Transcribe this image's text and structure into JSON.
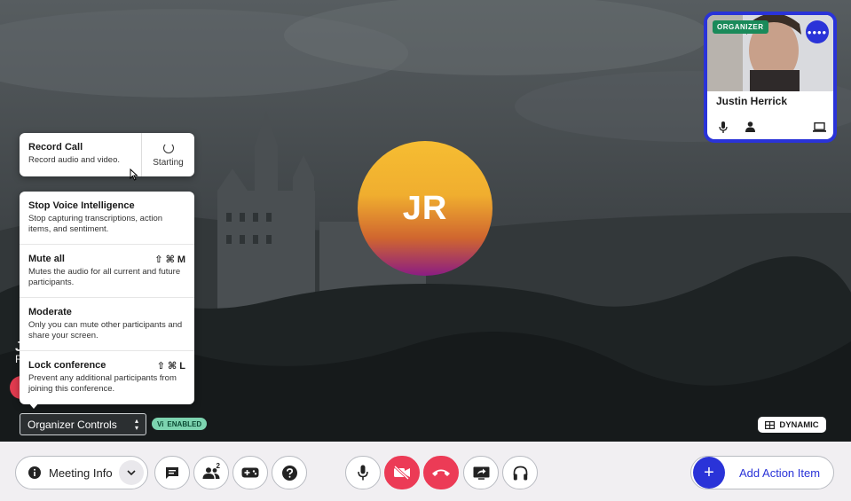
{
  "participant": {
    "badge": "ORGANIZER",
    "name": "Justin Herrick",
    "more_label": "••••"
  },
  "main_avatar": {
    "initials": "JR"
  },
  "record_menu": {
    "title": "Record Call",
    "description": "Record audio and video.",
    "status": "Starting"
  },
  "organizer_menu": {
    "items": [
      {
        "title": "Stop Voice Intelligence",
        "description": "Stop capturing transcriptions, action items, and sentiment.",
        "shortcut": ""
      },
      {
        "title": "Mute all",
        "description": "Mutes the audio for all current and future participants.",
        "shortcut": "⇧ ⌘ M"
      },
      {
        "title": "Moderate",
        "description": "Only you can mute other participants and share your screen.",
        "shortcut": ""
      },
      {
        "title": "Lock conference",
        "description": "Prevent any additional participants from joining this conference.",
        "shortcut": "⇧ ⌘ L"
      }
    ]
  },
  "controls_select": {
    "value": "Organizer Controls"
  },
  "vi_badge": {
    "prefix": "Vi",
    "label": "ENABLED"
  },
  "layout_badge": {
    "label": "DYNAMIC"
  },
  "left_fragment": {
    "initial": "J",
    "sub": "R"
  },
  "toolbar": {
    "meeting_info_label": "Meeting Info",
    "participants_count": "2",
    "action_item_label": "Add Action Item"
  },
  "colors": {
    "accent": "#2a33d8",
    "danger": "#ec3b56",
    "organizer_badge": "#1a8a5a",
    "enabled_badge": "#7dd4b0"
  }
}
